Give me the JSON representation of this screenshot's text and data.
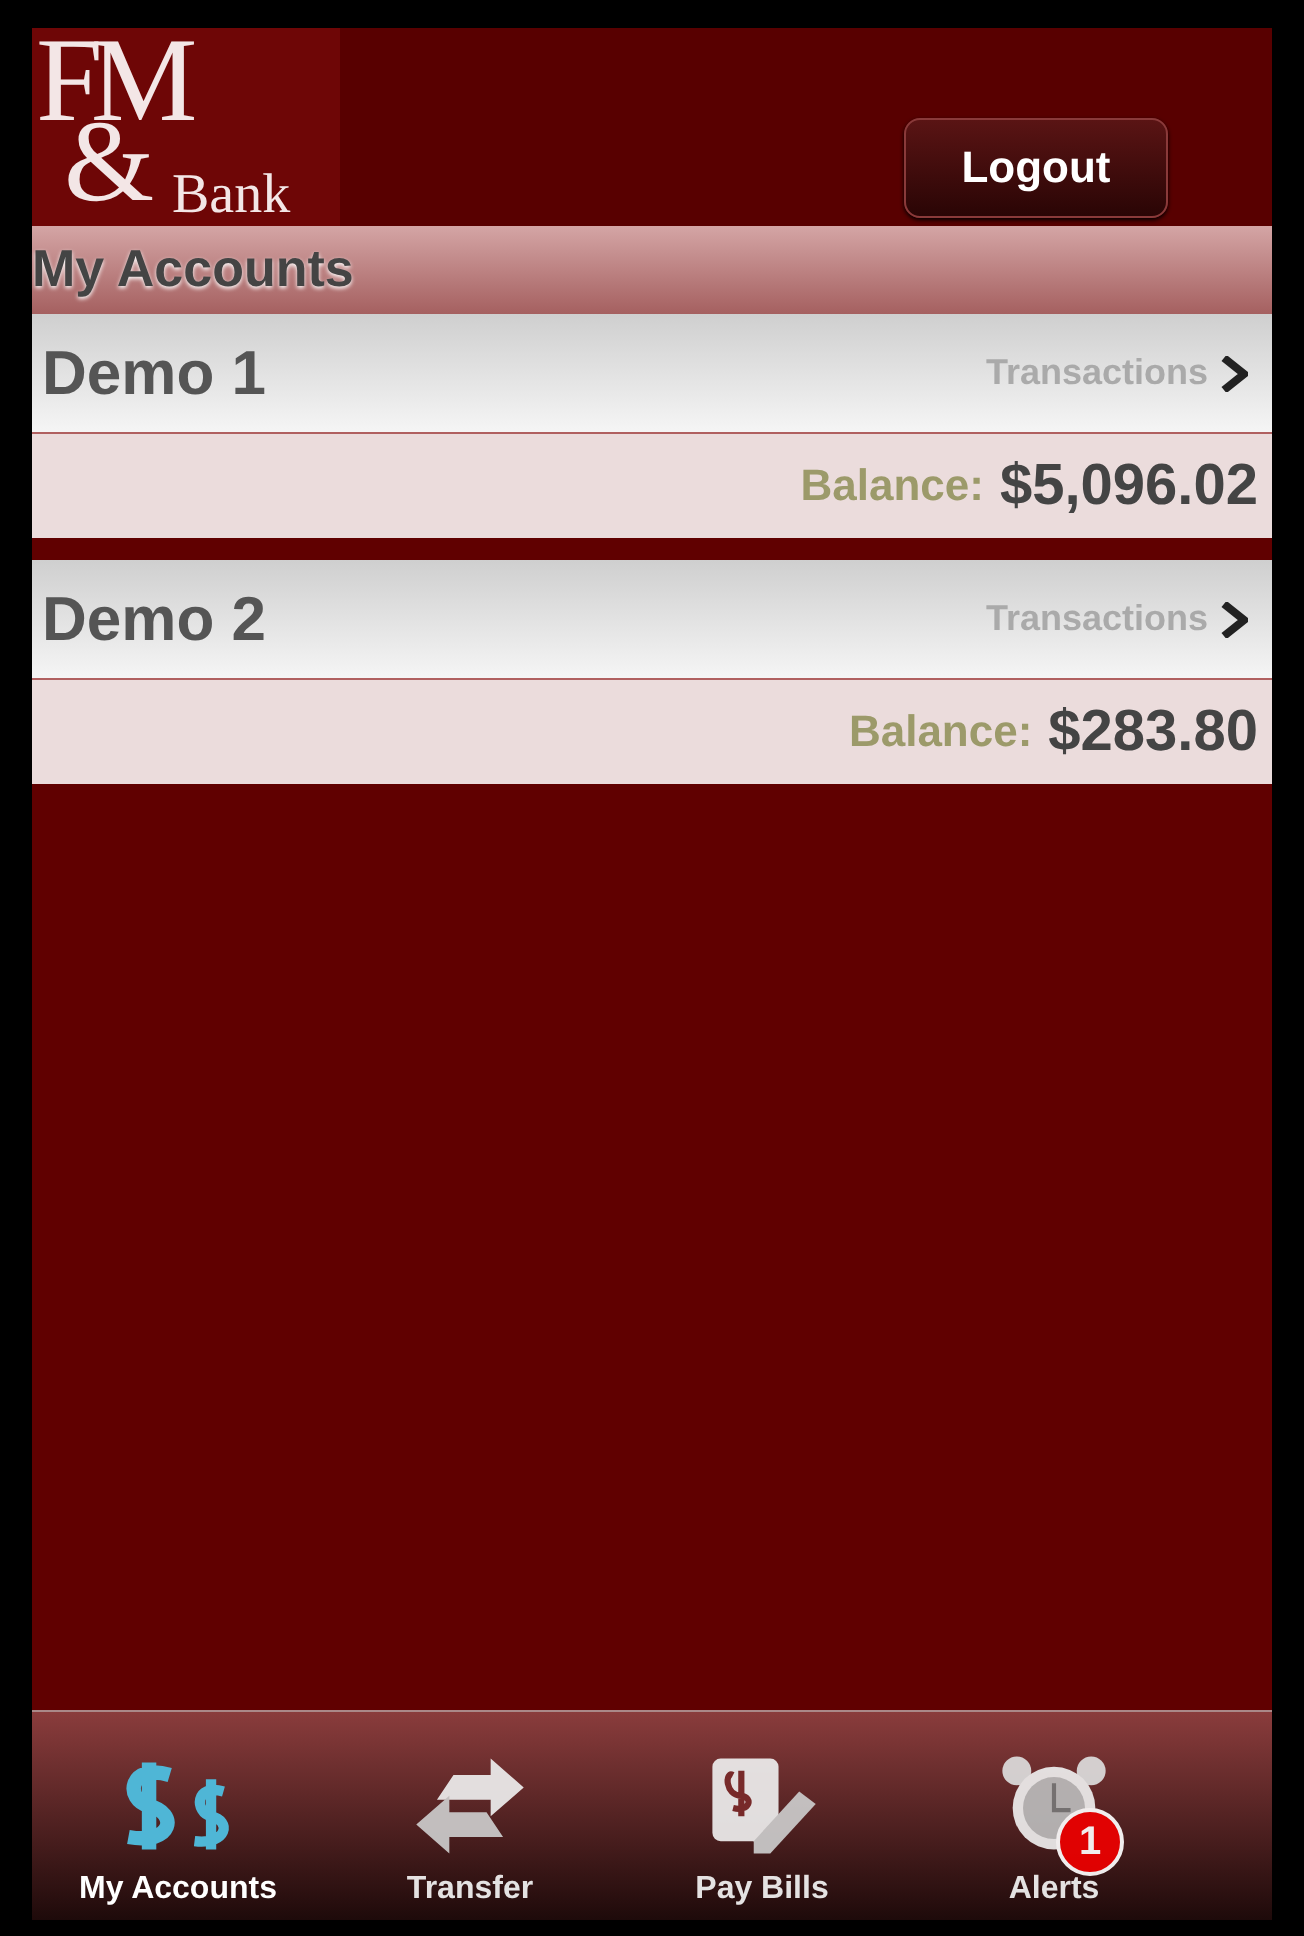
{
  "logo": {
    "initials": "FM",
    "ampersand": "&",
    "word": "Bank"
  },
  "logout_button": "Logout",
  "section_title": "My Accounts",
  "accounts": [
    {
      "name": "Demo 1",
      "link": "Transactions",
      "balance_label": "Balance:",
      "balance": "$5,096.02"
    },
    {
      "name": "Demo 2",
      "link": "Transactions",
      "balance_label": "Balance:",
      "balance": "$283.80"
    }
  ],
  "tabs": [
    {
      "kind": "dollars",
      "label": "My Accounts",
      "selected": true
    },
    {
      "kind": "transfer",
      "label": "Transfer",
      "selected": false
    },
    {
      "kind": "bill",
      "label": "Pay Bills",
      "selected": false
    },
    {
      "kind": "clock",
      "label": "Alerts",
      "selected": false,
      "badge": "1"
    }
  ]
}
